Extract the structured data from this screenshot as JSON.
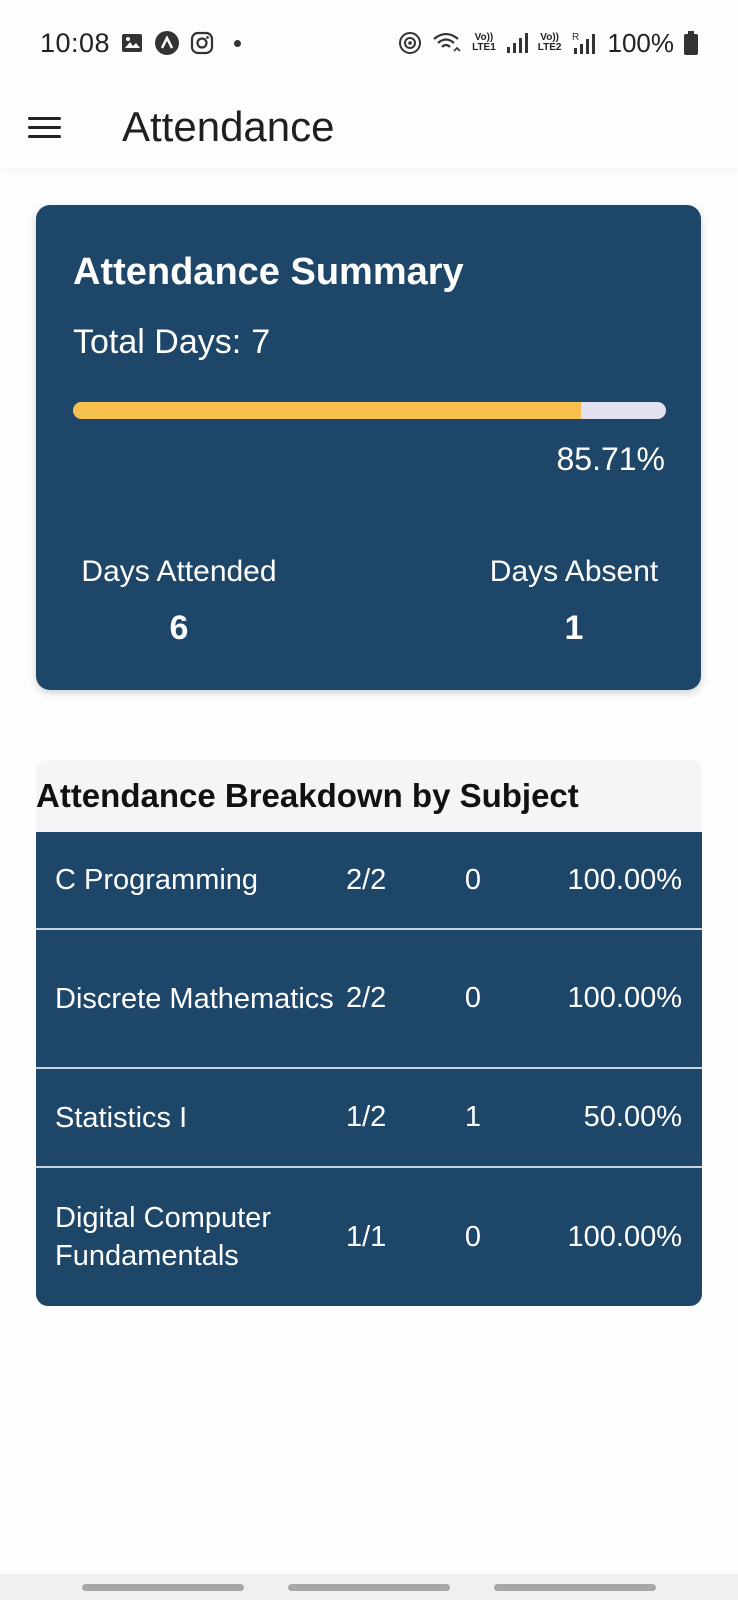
{
  "status_bar": {
    "time": "10:08",
    "net1": [
      "Vo))",
      "LTE1"
    ],
    "net2": [
      "Vo))",
      "LTE2"
    ],
    "roaming": "R",
    "battery": "100%"
  },
  "app_bar": {
    "title": "Attendance",
    "menu_icon": "hamburger-menu-icon"
  },
  "summary": {
    "title": "Attendance Summary",
    "total_days_label": "Total Days:",
    "total_days_value": "7",
    "progress_fraction": 0.8571,
    "percent_text": "85.71%",
    "attended_label": "Days Attended",
    "attended_value": "6",
    "absent_label": "Days Absent",
    "absent_value": "1",
    "card_color": "#1e4668",
    "progress_color": "#f8c04e"
  },
  "breakdown": {
    "title": "Attendance Breakdown by Subject",
    "rows": [
      {
        "subject": "C Programming",
        "ratio": "2/2",
        "absent": "0",
        "percent": "100.00%"
      },
      {
        "subject": "Discrete Mathematics",
        "ratio": "2/2",
        "absent": "0",
        "percent": "100.00%"
      },
      {
        "subject": "Statistics I",
        "ratio": "1/2",
        "absent": "1",
        "percent": "50.00%"
      },
      {
        "subject": "Digital Computer Fundamentals",
        "ratio": "1/1",
        "absent": "0",
        "percent": "100.00%"
      }
    ]
  }
}
